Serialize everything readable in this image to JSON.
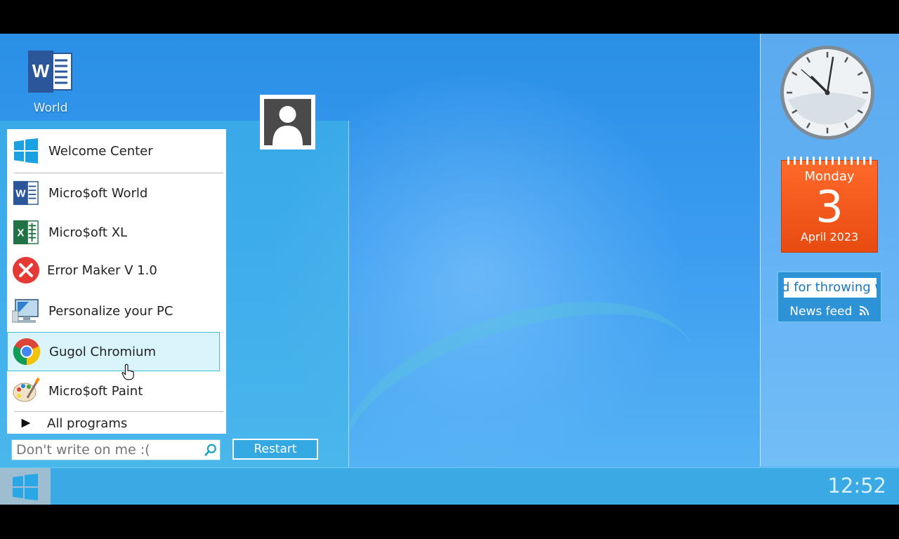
{
  "desktop": {
    "icons": [
      {
        "label": "World",
        "icon": "word-icon"
      }
    ]
  },
  "start_menu": {
    "items": [
      {
        "label": "Welcome Center",
        "icon": "windows-logo-icon"
      },
      {
        "label": "Micro$oft World",
        "icon": "word-icon"
      },
      {
        "label": "Micro$oft XL",
        "icon": "excel-icon"
      },
      {
        "label": "Error Maker V 1.0",
        "icon": "error-icon"
      },
      {
        "label": "Personalize your PC",
        "icon": "monitor-icon"
      },
      {
        "label": "Gugol Chromium",
        "icon": "chrome-icon"
      },
      {
        "label": "Micro$oft Paint",
        "icon": "paint-palette-icon"
      },
      {
        "label": "All programs",
        "icon": "play-arrow-icon"
      }
    ],
    "search": {
      "placeholder": "Don't write on me :("
    },
    "restart_label": "Restart"
  },
  "calendar": {
    "day_name": "Monday",
    "day": "3",
    "month_year": "April 2023"
  },
  "news": {
    "ticker_text": "d for throwing w",
    "label": "News feed"
  },
  "taskbar": {
    "time": "12:52"
  },
  "colors": {
    "accent": "#3ba9e4",
    "calendar": "#ff5a1a",
    "highlight": "#d9f4fb"
  }
}
